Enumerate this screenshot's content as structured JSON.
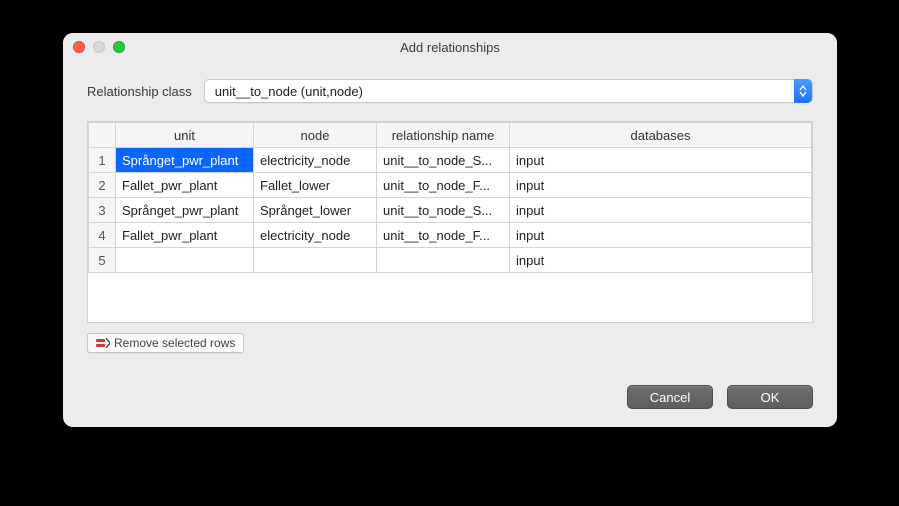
{
  "window": {
    "title": "Add relationships"
  },
  "form": {
    "class_label": "Relationship class",
    "class_value": "unit__to_node (unit,node)"
  },
  "table": {
    "headers": {
      "unit": "unit",
      "node": "node",
      "relationship": "relationship name",
      "databases": "databases"
    },
    "rows": [
      {
        "num": "1",
        "unit": "Språnget_pwr_plant",
        "node": "electricity_node",
        "rel": "unit__to_node_S...",
        "db": "input",
        "selected_col": "unit"
      },
      {
        "num": "2",
        "unit": "Fallet_pwr_plant",
        "node": "Fallet_lower",
        "rel": "unit__to_node_F...",
        "db": "input"
      },
      {
        "num": "3",
        "unit": "Språnget_pwr_plant",
        "node": "Språnget_lower",
        "rel": "unit__to_node_S...",
        "db": "input"
      },
      {
        "num": "4",
        "unit": "Fallet_pwr_plant",
        "node": "electricity_node",
        "rel": "unit__to_node_F...",
        "db": "input"
      },
      {
        "num": "5",
        "unit": "",
        "node": "",
        "rel": "",
        "db": "input"
      }
    ]
  },
  "buttons": {
    "remove": "Remove selected rows",
    "cancel": "Cancel",
    "ok": "OK"
  }
}
